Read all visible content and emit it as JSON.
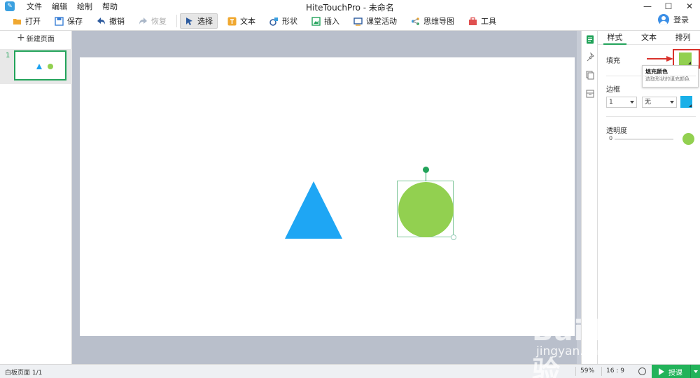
{
  "window": {
    "title": "HiteTouchPro - 未命名",
    "menu": [
      "文件",
      "编辑",
      "绘制",
      "帮助"
    ],
    "controls": [
      "—",
      "☐",
      "✕"
    ]
  },
  "toolbar": {
    "open": "打开",
    "save": "保存",
    "undo": "撤销",
    "redo": "恢复",
    "select": "选择",
    "text": "文本",
    "shape": "形状",
    "insert": "插入",
    "classroom": "课堂活动",
    "mindmap": "思维导图",
    "tools": "工具",
    "login": "登录"
  },
  "left_panel": {
    "new_page": "新建页面",
    "slides": [
      {
        "number": "1"
      }
    ]
  },
  "canvas": {
    "shapes": [
      {
        "type": "triangle",
        "color": "#1ea6f4"
      },
      {
        "type": "circle",
        "color": "#92d050",
        "selected": true
      }
    ]
  },
  "properties": {
    "tabs": [
      "样式",
      "文本",
      "排列"
    ],
    "active_tab": "样式",
    "fill_label": "填充",
    "fill_color": "#92d050",
    "tooltip_title": "填充颜色",
    "tooltip_desc": "选取形状的填充颜色",
    "border_label": "边框",
    "border_width": "1",
    "border_style": "无",
    "border_color": "#1ab0e8",
    "opacity_label": "透明度",
    "opacity_value": "0"
  },
  "status": {
    "page_info": "白板页面 1/1",
    "zoom": "59%",
    "ratio": "16 : 9",
    "teach": "授课"
  },
  "watermark": {
    "main": "Baidu经验",
    "sub": "jingyan.baidu.com"
  }
}
